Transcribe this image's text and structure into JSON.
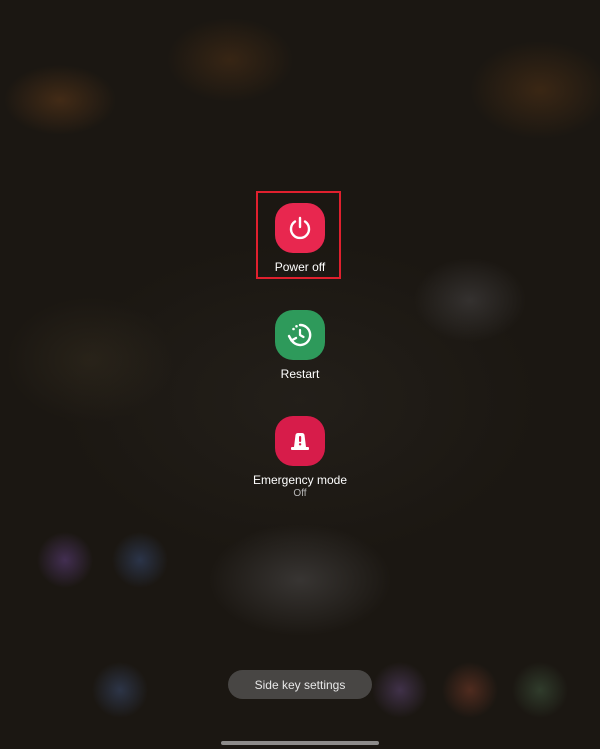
{
  "power_menu": {
    "items": [
      {
        "label": "Power off",
        "icon": "power-icon",
        "color": "#E8274F"
      },
      {
        "label": "Restart",
        "icon": "restart-icon",
        "color": "#2E9A5B"
      },
      {
        "label": "Emergency mode",
        "sublabel": "Off",
        "icon": "emergency-beacon-icon",
        "color": "#D71C4A"
      }
    ],
    "highlight_color": "#E0202E"
  },
  "side_key_settings": {
    "label": "Side key settings"
  }
}
